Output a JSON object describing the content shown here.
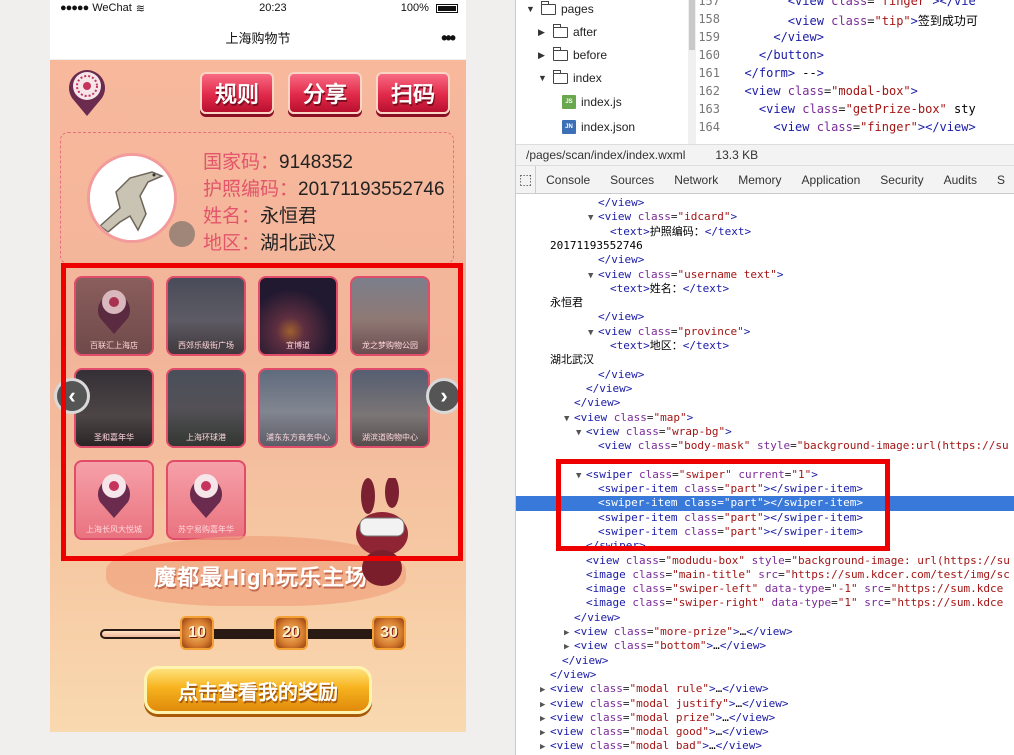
{
  "status_bar": {
    "carrier": "WeChat",
    "signal": "●●●●●",
    "time": "20:23",
    "battery": "100%"
  },
  "nav": {
    "title": "上海购物节",
    "more": "•••"
  },
  "top_buttons": {
    "rule": "规则",
    "share": "分享",
    "scan": "扫码"
  },
  "info": {
    "country_label": "国家码：",
    "country_value": "9148352",
    "passport_label": "护照编码：",
    "passport_value": "20171193552746",
    "name_label": "姓名：",
    "name_value": "永恒君",
    "region_label": "地区：",
    "region_value": "湖北武汉"
  },
  "swiper": {
    "tiles": [
      {
        "caption": "百联汇上海店"
      },
      {
        "caption": "西郊乐级街广场"
      },
      {
        "caption": "宜博道"
      },
      {
        "caption": "龙之梦购物公园"
      },
      {
        "caption": "圣和嘉年华"
      },
      {
        "caption": "上海环球港"
      },
      {
        "caption": "浦东东方商务中心"
      },
      {
        "caption": "湖滨道购物中心"
      },
      {
        "caption": "上海长风大悦城"
      },
      {
        "caption": "苏宁易购嘉年华"
      }
    ]
  },
  "banner": {
    "title": "魔都最High玩乐主场"
  },
  "milestones": {
    "m10": "10",
    "m20": "20",
    "m30": "30",
    "progress_fraction": 0.27
  },
  "reward_button": "点击查看我的奖励",
  "colors": {
    "accent_red": "#e12a4a",
    "highlight": "#e00000",
    "devtools_selection": "#3879d9"
  },
  "devtools": {
    "files": {
      "pages": "pages",
      "after": "after",
      "before": "before",
      "index": "index",
      "index_js": "index.js",
      "index_json": "index.json",
      "js_tag": "JS",
      "json_tag": "JN"
    },
    "code_lines": [
      {
        "ln": "157",
        "indent": "        ",
        "html": "<view class=\"finger\"></vie"
      },
      {
        "ln": "158",
        "indent": "        ",
        "html": "<view class=\"tip\">签到成功可"
      },
      {
        "ln": "159",
        "indent": "      ",
        "html": "</view>"
      },
      {
        "ln": "160",
        "indent": "    ",
        "html": "</button>"
      },
      {
        "ln": "161",
        "indent": "  ",
        "html": "</form> -->"
      },
      {
        "ln": "162",
        "indent": "  ",
        "html": "<view class=\"modal-box\">"
      },
      {
        "ln": "163",
        "indent": "    ",
        "html": "<view class=\"getPrize-box\" sty"
      },
      {
        "ln": "164",
        "indent": "      ",
        "html": "<view class=\"finger\"></view>"
      }
    ],
    "file_path": "/pages/scan/index/index.wxml",
    "file_size": "13.3 KB",
    "tabs": [
      "Console",
      "Sources",
      "Network",
      "Memory",
      "Application",
      "Security",
      "Audits",
      "S"
    ],
    "dom_lines": [
      {
        "i": 4,
        "t": "",
        "text": "</view>"
      },
      {
        "i": 4,
        "t": "▼",
        "text": "<view class=\"idcard\">"
      },
      {
        "i": 5,
        "t": "",
        "text": "<text>护照编码：</text>"
      },
      {
        "i": 0,
        "t": "",
        "text": "20171193552746"
      },
      {
        "i": 4,
        "t": "",
        "text": "</view>"
      },
      {
        "i": 4,
        "t": "▼",
        "text": "<view class=\"username text\">"
      },
      {
        "i": 5,
        "t": "",
        "text": "<text>姓名：</text>"
      },
      {
        "i": 0,
        "t": "",
        "text": "永恒君"
      },
      {
        "i": 4,
        "t": "",
        "text": "</view>"
      },
      {
        "i": 4,
        "t": "▼",
        "text": "<view class=\"province\">"
      },
      {
        "i": 5,
        "t": "",
        "text": "<text>地区：</text>"
      },
      {
        "i": 0,
        "t": "",
        "text": "湖北武汉"
      },
      {
        "i": 4,
        "t": "",
        "text": "</view>"
      },
      {
        "i": 3,
        "t": "",
        "text": "</view>"
      },
      {
        "i": 2,
        "t": "",
        "text": "</view>"
      },
      {
        "i": 2,
        "t": "▼",
        "text": "<view class=\"map\">"
      },
      {
        "i": 3,
        "t": "▼",
        "text": "<view class=\"wrap-bg\">"
      },
      {
        "i": 4,
        "t": "",
        "text": "<view class=\"body-mask\" style=\"background-image:url(https://su"
      },
      {
        "i": 4,
        "t": "",
        "text": ""
      },
      {
        "i": 3,
        "t": "▼",
        "text": "<swiper class=\"swiper\" current=\"1\">"
      },
      {
        "i": 4,
        "t": "",
        "text": "<swiper-item class=\"part\"></swiper-item>"
      },
      {
        "i": 4,
        "t": "",
        "text": "<swiper-item class=\"part\"></swiper-item>",
        "sel": true
      },
      {
        "i": 4,
        "t": "",
        "text": "<swiper-item class=\"part\"></swiper-item>"
      },
      {
        "i": 4,
        "t": "",
        "text": "<swiper-item class=\"part\"></swiper-item>"
      },
      {
        "i": 3,
        "t": "",
        "text": "</swiper>"
      },
      {
        "i": 3,
        "t": "",
        "text": "<view class=\"modudu-box\" style=\"background-image: url(https://su"
      },
      {
        "i": 3,
        "t": "",
        "text": "<image class=\"main-title\" src=\"https://sum.kdcer.com/test/img/sc"
      },
      {
        "i": 3,
        "t": "",
        "text": "<image class=\"swiper-left\" data-type=\"-1\" src=\"https://sum.kdce"
      },
      {
        "i": 3,
        "t": "",
        "text": "<image class=\"swiper-right\" data-type=\"1\" src=\"https://sum.kdce"
      },
      {
        "i": 2,
        "t": "",
        "text": "</view>"
      },
      {
        "i": 2,
        "t": "▶",
        "text": "<view class=\"more-prize\">…</view>"
      },
      {
        "i": 2,
        "t": "▶",
        "text": "<view class=\"bottom\">…</view>"
      },
      {
        "i": 1,
        "t": "",
        "text": "</view>"
      },
      {
        "i": 0,
        "t": "",
        "text": "</view>"
      },
      {
        "i": 0,
        "t": "▶",
        "text": "<view class=\"modal rule\">…</view>"
      },
      {
        "i": 0,
        "t": "▶",
        "text": "<view class=\"modal justify\">…</view>"
      },
      {
        "i": 0,
        "t": "▶",
        "text": "<view class=\"modal prize\">…</view>"
      },
      {
        "i": 0,
        "t": "▶",
        "text": "<view class=\"modal good\">…</view>"
      },
      {
        "i": 0,
        "t": "▶",
        "text": "<view class=\"modal bad\">…</view>"
      }
    ]
  }
}
